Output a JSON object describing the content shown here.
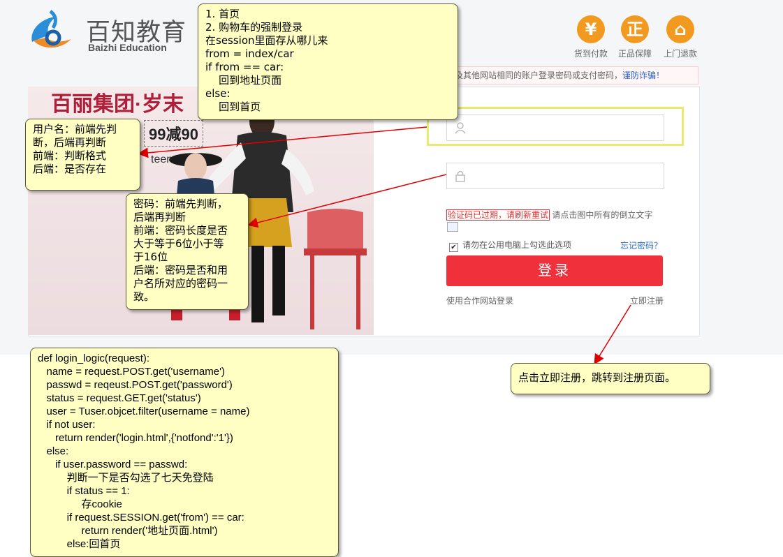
{
  "header": {
    "logo_cn": "百知教育",
    "logo_en": "Baizhi Education",
    "badges": [
      {
        "icon": "yen-icon",
        "glyph": "¥",
        "label": "货到付款"
      },
      {
        "icon": "genuine-icon",
        "glyph": "正",
        "label": "正品保障"
      },
      {
        "icon": "return-icon",
        "glyph": "⌂",
        "label": "上门退款"
      }
    ],
    "warning_text": "及其他网站相同的账户登录密码或支付密码，",
    "warning_link": "谨防诈骗！"
  },
  "banner": {
    "headline": "百丽集团·岁末",
    "promo": "99减90",
    "brand": "teenmix"
  },
  "login": {
    "username_placeholder": "",
    "password_placeholder": "",
    "captcha_error": "验证码已过期，请刷新重试",
    "captcha_hint": "请点击图中所有的倒立文字",
    "remember_label": "请勿在公用电脑上勾选此选项",
    "remember_checked": true,
    "forgot_label": "忘记密码？",
    "submit_label": "登录",
    "partner_label": "使用合作网站登录",
    "register_label": "立即注册"
  },
  "notes": {
    "top": "1. 首页\n2. 购物车的强制登录\n在session里面存从哪儿来\nfrom = index/car\nif from == car:\n    回到地址页面\nelse:\n    回到首页",
    "username": "用户名：前端先判\n断，后端再判断\n前端：判断格式\n后端：是否存在",
    "password": "密码：前端先判断，\n后端再判断\n前端：密码长度是否\n大于等于6位小于等\n于16位\n后端：密码是否和用\n户名所对应的密码一\n致。",
    "register": "点击立即注册，跳转到注册页面。",
    "code": "def login_logic(request):\n   name = request.POST.get('username')\n   passwd = reqeust.POST.get('password')\n   status = request.GET.get('status')\n   user = Tuser.objcet.filter(username = name)\n   if not user:\n      return render('login.html',{'notfond':'1'})\n   else:\n      if user.password == passwd:\n          判断一下是否勾选了七天免登陆\n          if status == 1:\n               存cookie\n          if request.SESSION.get('from') == car:\n               return render('地址页面.html')\n          else:回首页"
  }
}
